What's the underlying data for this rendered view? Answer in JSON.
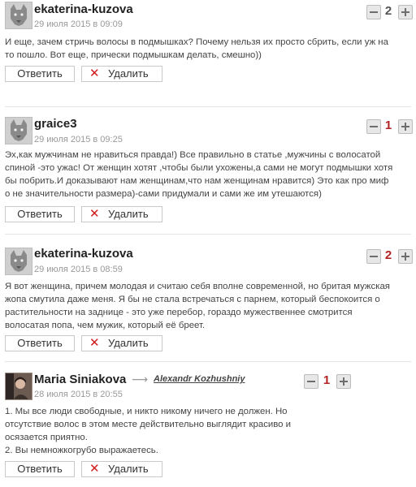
{
  "comments": [
    {
      "author": "ekaterina-kuzova",
      "date": "29 июля 2015 в 09:09",
      "score": "2",
      "score_color": "#555555",
      "lines": [
        "И еще, зачем стричь волосы в подмышках? Почему нельзя их просто сбрить, если уж на",
        "то пошло. Вот еще, прически подмышкам делать, смешно))"
      ],
      "reply_label": "Ответить",
      "delete_label": "Удалить",
      "avatar_icon": "wolf-avatar-icon"
    },
    {
      "author": "graice3",
      "date": "29 июля 2015 в 09:25",
      "score": "1",
      "score_color": "#b22222",
      "lines": [
        "Эх,как мужчинам не нравиться правда!) Все правильно в статье ,мужчины с волосатой",
        "спиной -это ужас! От женщин хотят ,чтобы были ухожены,а сами не могут подмышки хотя",
        "бы побрить.И доказывают нам женщинам,что нам женщинам нравится) Это как про миф",
        "о не значительности размера)-сами придумали и сами же им утешаются)"
      ],
      "reply_label": "Ответить",
      "delete_label": "Удалить",
      "avatar_icon": "wolf-avatar-icon"
    },
    {
      "author": "ekaterina-kuzova",
      "date": "29 июля 2015 в 08:59",
      "score": "2",
      "score_color": "#b22222",
      "lines": [
        "Я вот женщина, причем молодая и считаю себя вполне современной, но бритая мужская",
        "жопа смутила даже меня. Я бы не стала встречаться с парнем, который беспокоится о",
        "растительности на заднице - это уже перебор, гораздо мужественнее смотрится",
        "волосатая попа, чем мужик, который её бреет."
      ],
      "reply_label": "Ответить",
      "delete_label": "Удалить",
      "avatar_icon": "wolf-avatar-icon"
    },
    {
      "author": "Maria Siniakova",
      "reply_to": "Alexandr Kozhushniy",
      "date": "28 июля 2015 в 20:55",
      "score": "1",
      "score_color": "#b22222",
      "lines": [
        "1. Мы все люди свободные, и никто никому ничего не должен. Но",
        "отсутствие волос в этом месте действительно выглядит красиво и",
        "осязается приятно.",
        "2. Вы немножкогрубо выражаетесь."
      ],
      "reply_label": "Ответить",
      "delete_label": "Удалить",
      "avatar_icon": "user-photo-avatar"
    }
  ],
  "icons": {
    "minus": "minus-icon",
    "plus": "plus-icon",
    "delete": "close-icon",
    "reply_arrow": "arrow-right-icon"
  },
  "glyphs": {
    "delete_x": "✕",
    "reply_arrow": "⟶"
  }
}
